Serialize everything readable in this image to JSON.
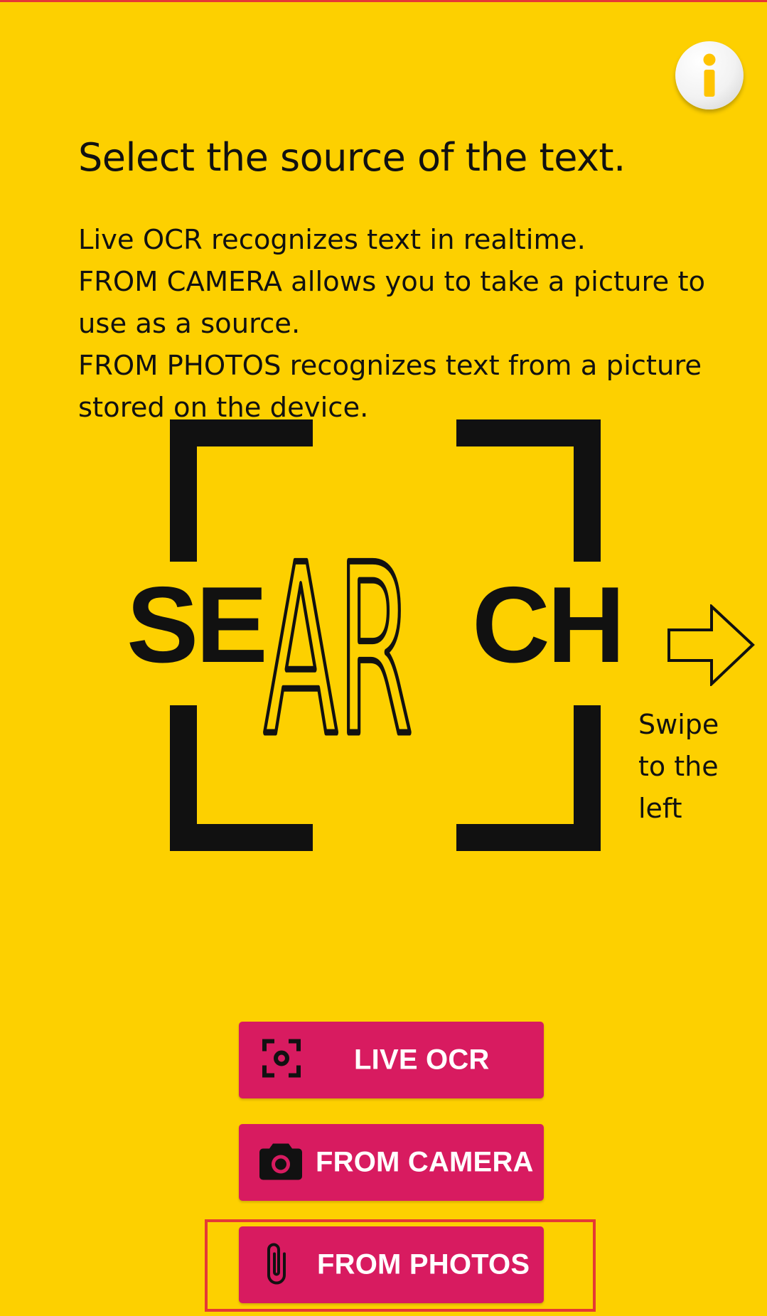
{
  "info_button": {
    "icon": "info-icon"
  },
  "instructions": {
    "title": "Select the source of the text.",
    "lines": [
      "Live OCR recognizes text in realtime.",
      "FROM CAMERA allows you to take a picture to",
      "use as a source.",
      "FROM PHOTOS recognizes text from a picture",
      "stored on the device."
    ]
  },
  "logo": {
    "text_left": "SE",
    "text_center": "AR",
    "text_right": "CH"
  },
  "swipe_hint": {
    "icon": "arrow-right-icon",
    "lines": [
      "Swipe",
      "to the",
      "left"
    ]
  },
  "buttons": {
    "live_ocr": {
      "label": "LIVE OCR",
      "icon": "focus-frame-icon"
    },
    "from_camera": {
      "label": "FROM CAMERA",
      "icon": "camera-icon"
    },
    "from_photos": {
      "label": "FROM PHOTOS",
      "icon": "paperclip-icon"
    }
  },
  "colors": {
    "background": "#FDD000",
    "button": "#D81B60",
    "button_text": "#FFFFFF",
    "text": "#111111",
    "highlight": "#E53935"
  }
}
